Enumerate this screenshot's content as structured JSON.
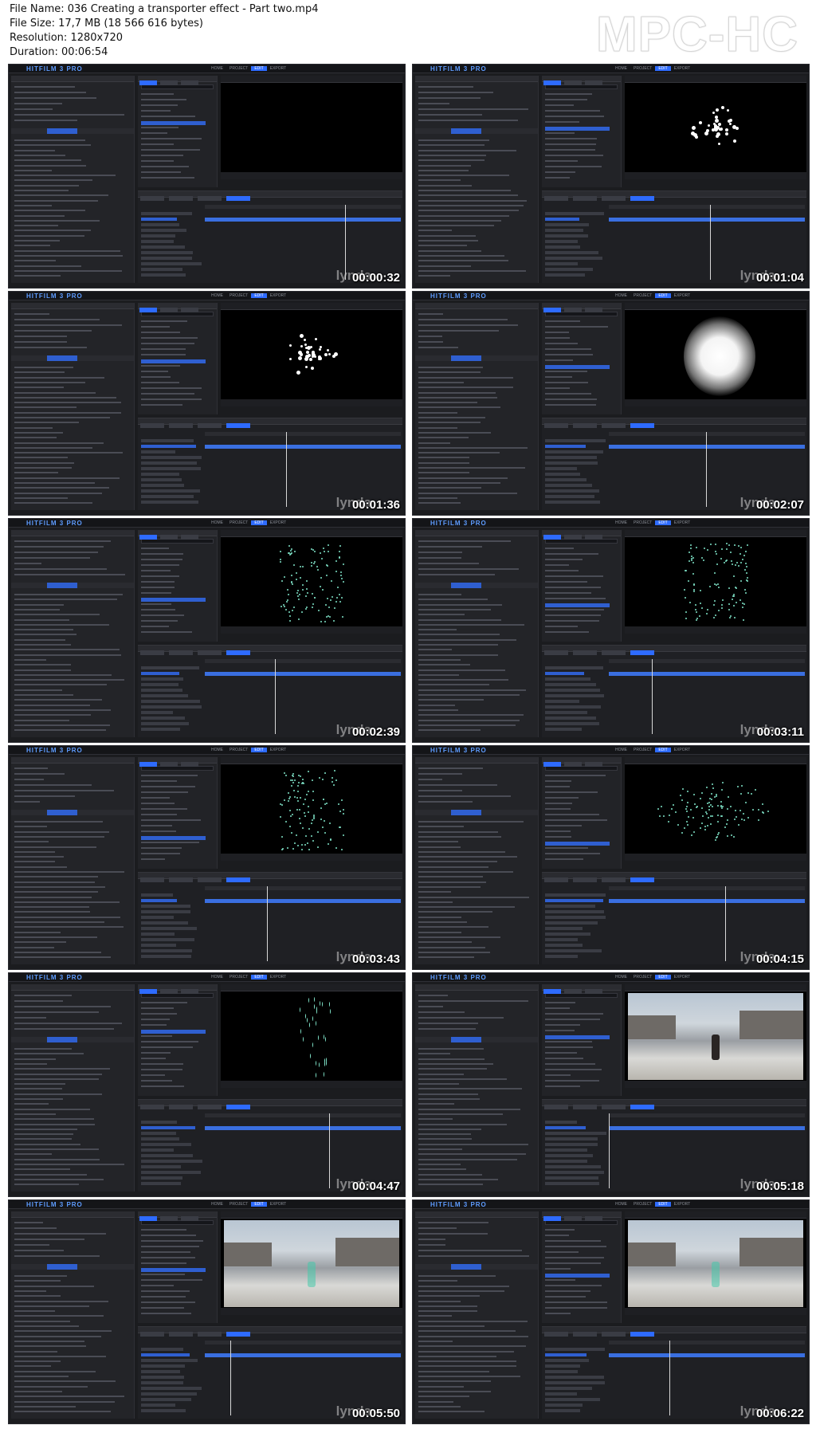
{
  "header": {
    "file_name": "File Name: 036 Creating a transporter effect - Part two.mp4",
    "file_size": "File Size: 17,7 MB (18 566 616 bytes)",
    "resolution": "Resolution: 1280x720",
    "duration": "Duration: 00:06:54",
    "brand": "MPC-HC"
  },
  "app": {
    "logo": "HITFILM 3 PRO",
    "menu": [
      "HOME",
      "PROJECT",
      "EDIT",
      "EXPORT"
    ],
    "active_menu": "EDIT",
    "watermark": "lynda"
  },
  "thumbnails": [
    {
      "timestamp": "00:00:32",
      "viewer": "empty",
      "playhead": 0.72
    },
    {
      "timestamp": "00:01:04",
      "viewer": "particles",
      "playhead": 0.52
    },
    {
      "timestamp": "00:01:36",
      "viewer": "particles",
      "playhead": 0.42
    },
    {
      "timestamp": "00:02:07",
      "viewer": "glow",
      "playhead": 0.5
    },
    {
      "timestamp": "00:02:39",
      "viewer": "sparks",
      "playhead": 0.36
    },
    {
      "timestamp": "00:03:11",
      "viewer": "sparks",
      "playhead": 0.22
    },
    {
      "timestamp": "00:03:43",
      "viewer": "sparks",
      "playhead": 0.32
    },
    {
      "timestamp": "00:04:15",
      "viewer": "swirl",
      "playhead": 0.6
    },
    {
      "timestamp": "00:04:47",
      "viewer": "streaks",
      "playhead": 0.64
    },
    {
      "timestamp": "00:05:18",
      "viewer": "photo",
      "playhead": 0.0
    },
    {
      "timestamp": "00:05:50",
      "viewer": "photo",
      "playhead": 0.13
    },
    {
      "timestamp": "00:06:22",
      "viewer": "photo",
      "playhead": 0.31
    }
  ]
}
